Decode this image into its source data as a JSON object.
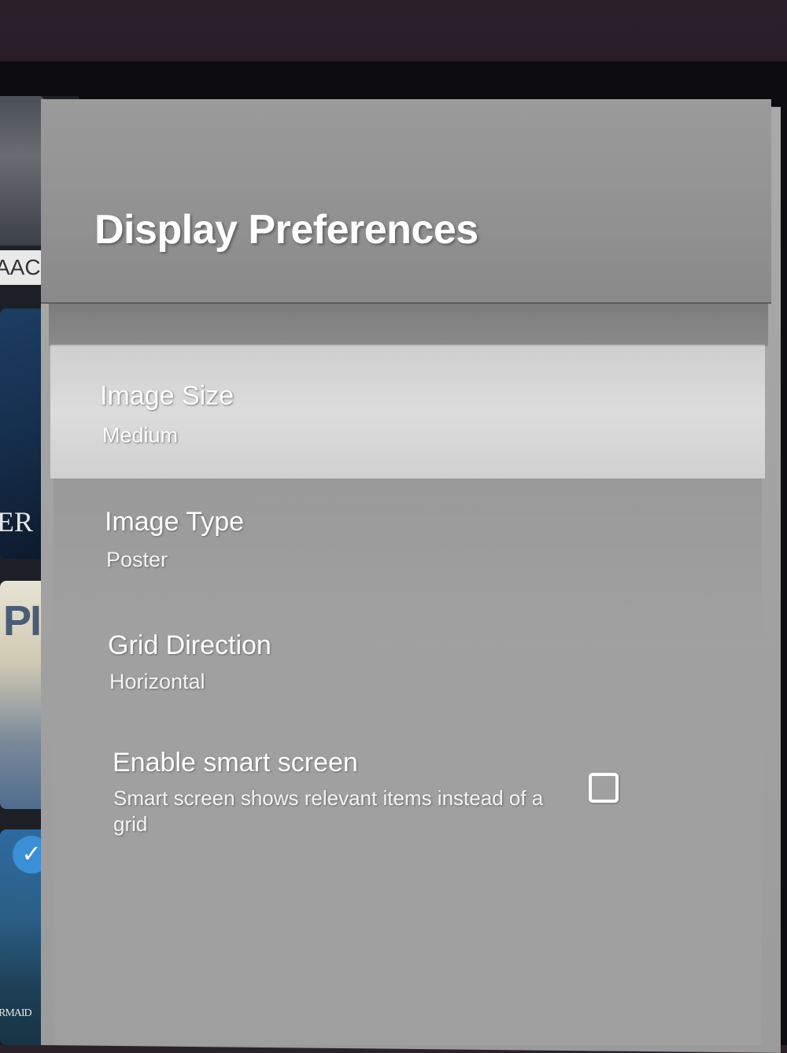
{
  "panel": {
    "title": "Display Preferences"
  },
  "settings": [
    {
      "label": "Image Size",
      "value": "Medium",
      "focused": true
    },
    {
      "label": "Image Type",
      "value": "Poster",
      "focused": false
    },
    {
      "label": "Grid Direction",
      "value": "Horizontal",
      "focused": false
    },
    {
      "label": "Enable smart screen",
      "description": "Smart screen shows relevant items instead of a grid",
      "checked": false
    }
  ],
  "background_posters": [
    {
      "visible_text": "AAC"
    },
    {
      "visible_text": "ER"
    },
    {
      "visible_text": "PI"
    },
    {
      "visible_text": "RMAID",
      "watched": true
    }
  ],
  "icons": {
    "watched": "check-icon",
    "toggle": "checkbox-icon"
  },
  "colors": {
    "panel_bg": "#a3a3a3",
    "header_bg": "#8f8f8f",
    "focused_row_bg": "#d6d6d6",
    "text": "#ffffff",
    "accent": "#3b8fd6"
  }
}
